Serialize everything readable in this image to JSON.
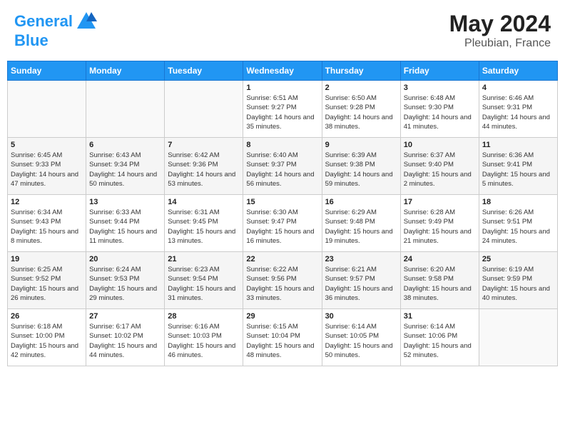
{
  "header": {
    "logo_line1": "General",
    "logo_line2": "Blue",
    "month": "May 2024",
    "location": "Pleubian, France"
  },
  "days_of_week": [
    "Sunday",
    "Monday",
    "Tuesday",
    "Wednesday",
    "Thursday",
    "Friday",
    "Saturday"
  ],
  "weeks": [
    [
      {
        "day": "",
        "sunrise": "",
        "sunset": "",
        "daylight": ""
      },
      {
        "day": "",
        "sunrise": "",
        "sunset": "",
        "daylight": ""
      },
      {
        "day": "",
        "sunrise": "",
        "sunset": "",
        "daylight": ""
      },
      {
        "day": "1",
        "sunrise": "Sunrise: 6:51 AM",
        "sunset": "Sunset: 9:27 PM",
        "daylight": "Daylight: 14 hours and 35 minutes."
      },
      {
        "day": "2",
        "sunrise": "Sunrise: 6:50 AM",
        "sunset": "Sunset: 9:28 PM",
        "daylight": "Daylight: 14 hours and 38 minutes."
      },
      {
        "day": "3",
        "sunrise": "Sunrise: 6:48 AM",
        "sunset": "Sunset: 9:30 PM",
        "daylight": "Daylight: 14 hours and 41 minutes."
      },
      {
        "day": "4",
        "sunrise": "Sunrise: 6:46 AM",
        "sunset": "Sunset: 9:31 PM",
        "daylight": "Daylight: 14 hours and 44 minutes."
      }
    ],
    [
      {
        "day": "5",
        "sunrise": "Sunrise: 6:45 AM",
        "sunset": "Sunset: 9:33 PM",
        "daylight": "Daylight: 14 hours and 47 minutes."
      },
      {
        "day": "6",
        "sunrise": "Sunrise: 6:43 AM",
        "sunset": "Sunset: 9:34 PM",
        "daylight": "Daylight: 14 hours and 50 minutes."
      },
      {
        "day": "7",
        "sunrise": "Sunrise: 6:42 AM",
        "sunset": "Sunset: 9:36 PM",
        "daylight": "Daylight: 14 hours and 53 minutes."
      },
      {
        "day": "8",
        "sunrise": "Sunrise: 6:40 AM",
        "sunset": "Sunset: 9:37 PM",
        "daylight": "Daylight: 14 hours and 56 minutes."
      },
      {
        "day": "9",
        "sunrise": "Sunrise: 6:39 AM",
        "sunset": "Sunset: 9:38 PM",
        "daylight": "Daylight: 14 hours and 59 minutes."
      },
      {
        "day": "10",
        "sunrise": "Sunrise: 6:37 AM",
        "sunset": "Sunset: 9:40 PM",
        "daylight": "Daylight: 15 hours and 2 minutes."
      },
      {
        "day": "11",
        "sunrise": "Sunrise: 6:36 AM",
        "sunset": "Sunset: 9:41 PM",
        "daylight": "Daylight: 15 hours and 5 minutes."
      }
    ],
    [
      {
        "day": "12",
        "sunrise": "Sunrise: 6:34 AM",
        "sunset": "Sunset: 9:43 PM",
        "daylight": "Daylight: 15 hours and 8 minutes."
      },
      {
        "day": "13",
        "sunrise": "Sunrise: 6:33 AM",
        "sunset": "Sunset: 9:44 PM",
        "daylight": "Daylight: 15 hours and 11 minutes."
      },
      {
        "day": "14",
        "sunrise": "Sunrise: 6:31 AM",
        "sunset": "Sunset: 9:45 PM",
        "daylight": "Daylight: 15 hours and 13 minutes."
      },
      {
        "day": "15",
        "sunrise": "Sunrise: 6:30 AM",
        "sunset": "Sunset: 9:47 PM",
        "daylight": "Daylight: 15 hours and 16 minutes."
      },
      {
        "day": "16",
        "sunrise": "Sunrise: 6:29 AM",
        "sunset": "Sunset: 9:48 PM",
        "daylight": "Daylight: 15 hours and 19 minutes."
      },
      {
        "day": "17",
        "sunrise": "Sunrise: 6:28 AM",
        "sunset": "Sunset: 9:49 PM",
        "daylight": "Daylight: 15 hours and 21 minutes."
      },
      {
        "day": "18",
        "sunrise": "Sunrise: 6:26 AM",
        "sunset": "Sunset: 9:51 PM",
        "daylight": "Daylight: 15 hours and 24 minutes."
      }
    ],
    [
      {
        "day": "19",
        "sunrise": "Sunrise: 6:25 AM",
        "sunset": "Sunset: 9:52 PM",
        "daylight": "Daylight: 15 hours and 26 minutes."
      },
      {
        "day": "20",
        "sunrise": "Sunrise: 6:24 AM",
        "sunset": "Sunset: 9:53 PM",
        "daylight": "Daylight: 15 hours and 29 minutes."
      },
      {
        "day": "21",
        "sunrise": "Sunrise: 6:23 AM",
        "sunset": "Sunset: 9:54 PM",
        "daylight": "Daylight: 15 hours and 31 minutes."
      },
      {
        "day": "22",
        "sunrise": "Sunrise: 6:22 AM",
        "sunset": "Sunset: 9:56 PM",
        "daylight": "Daylight: 15 hours and 33 minutes."
      },
      {
        "day": "23",
        "sunrise": "Sunrise: 6:21 AM",
        "sunset": "Sunset: 9:57 PM",
        "daylight": "Daylight: 15 hours and 36 minutes."
      },
      {
        "day": "24",
        "sunrise": "Sunrise: 6:20 AM",
        "sunset": "Sunset: 9:58 PM",
        "daylight": "Daylight: 15 hours and 38 minutes."
      },
      {
        "day": "25",
        "sunrise": "Sunrise: 6:19 AM",
        "sunset": "Sunset: 9:59 PM",
        "daylight": "Daylight: 15 hours and 40 minutes."
      }
    ],
    [
      {
        "day": "26",
        "sunrise": "Sunrise: 6:18 AM",
        "sunset": "Sunset: 10:00 PM",
        "daylight": "Daylight: 15 hours and 42 minutes."
      },
      {
        "day": "27",
        "sunrise": "Sunrise: 6:17 AM",
        "sunset": "Sunset: 10:02 PM",
        "daylight": "Daylight: 15 hours and 44 minutes."
      },
      {
        "day": "28",
        "sunrise": "Sunrise: 6:16 AM",
        "sunset": "Sunset: 10:03 PM",
        "daylight": "Daylight: 15 hours and 46 minutes."
      },
      {
        "day": "29",
        "sunrise": "Sunrise: 6:15 AM",
        "sunset": "Sunset: 10:04 PM",
        "daylight": "Daylight: 15 hours and 48 minutes."
      },
      {
        "day": "30",
        "sunrise": "Sunrise: 6:14 AM",
        "sunset": "Sunset: 10:05 PM",
        "daylight": "Daylight: 15 hours and 50 minutes."
      },
      {
        "day": "31",
        "sunrise": "Sunrise: 6:14 AM",
        "sunset": "Sunset: 10:06 PM",
        "daylight": "Daylight: 15 hours and 52 minutes."
      },
      {
        "day": "",
        "sunrise": "",
        "sunset": "",
        "daylight": ""
      }
    ]
  ]
}
